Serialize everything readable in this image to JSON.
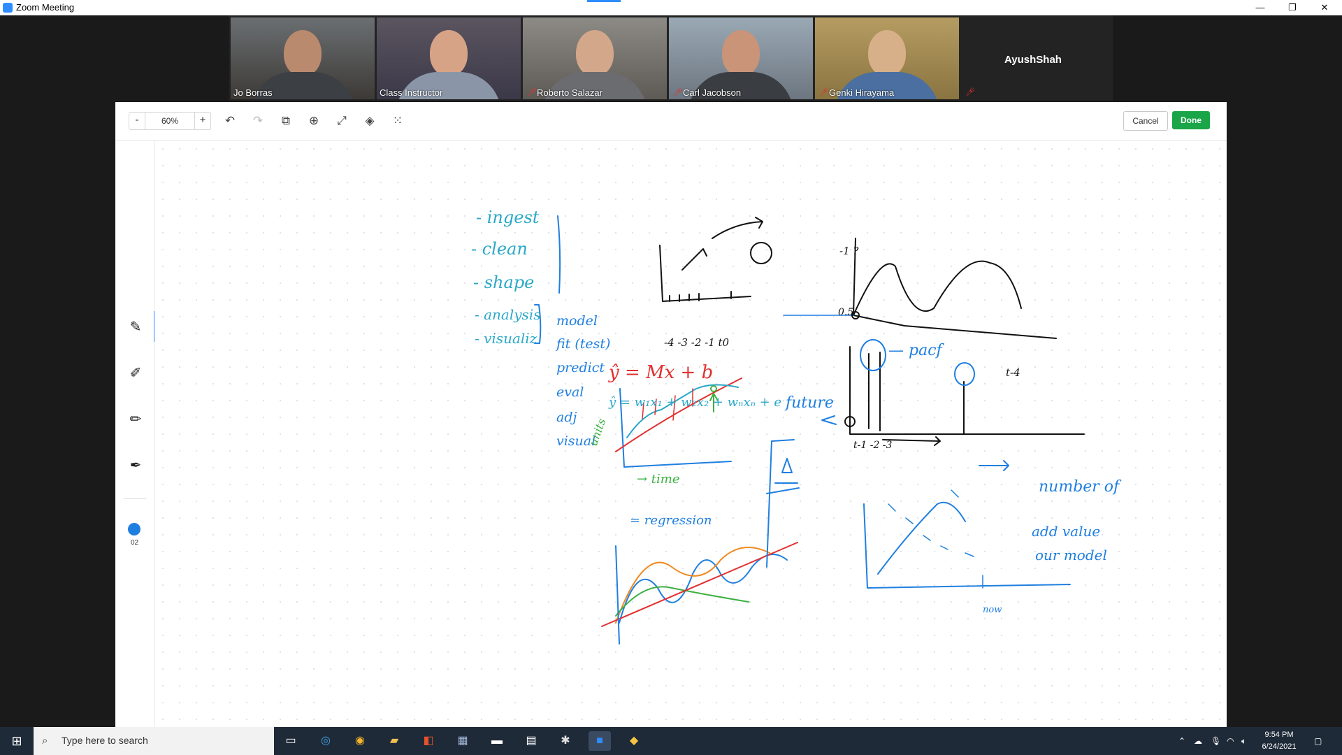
{
  "window": {
    "title": "Zoom Meeting",
    "controls": {
      "minimize": "—",
      "maximize": "❐",
      "close": "✕"
    }
  },
  "participants": [
    {
      "name": "Jo Borras",
      "muted": false,
      "active": false
    },
    {
      "name": "Class Instructor",
      "muted": false,
      "active": true
    },
    {
      "name": "Roberto Salazar",
      "muted": true,
      "active": false
    },
    {
      "name": "Carl Jacobson",
      "muted": true,
      "active": false
    },
    {
      "name": "Genki Hirayama",
      "muted": true,
      "active": false
    },
    {
      "name": "AyushShah",
      "muted": true,
      "active": false,
      "video": false
    }
  ],
  "toolbar": {
    "zoom_minus": "-",
    "zoom_value": "60%",
    "zoom_plus": "+",
    "cancel_label": "Cancel",
    "done_label": "Done",
    "done_color": "#1aa548"
  },
  "sidebar": {
    "stroke_color": "#1f7fe0",
    "stroke_size": "02"
  },
  "whiteboard": {
    "steps": [
      "- ingest",
      "- clean",
      "- shape",
      "- analysis",
      "- visualiz"
    ],
    "model_steps": [
      "model",
      "fit (test)",
      "predict",
      "eval",
      "adj",
      "visual"
    ],
    "ticks": "-4 -3 -2 -1   t0",
    "equation1": "ŷ = Mx + b",
    "equation2": "ŷ = w₁x₁ + w₂x₂ + wₙxₙ + e",
    "y_label_green": "units",
    "x_label_green": "→ time",
    "regression_label": "= regression",
    "label_future": "future",
    "label_pacf": "— pacf",
    "label_axis_top": "-1 ?",
    "label_axis_mid": "0.5",
    "label_tmin": "t-1 -2 -3",
    "label_tminus4": "t-4",
    "label_number": "number of",
    "label_addvalue": "add value",
    "label_ourmodel": "our model",
    "label_now": "now"
  },
  "taskbar": {
    "search_placeholder": "Type here to search",
    "time": "9:54 PM",
    "date": "6/24/2021"
  }
}
